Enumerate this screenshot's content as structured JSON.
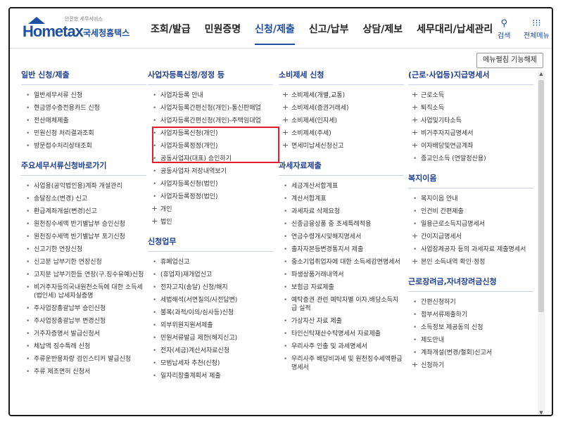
{
  "header": {
    "logo_tag": "안전한 세무서비스",
    "logo_brand": "Hometax",
    "logo_korean": "국세청홈택스",
    "nav": [
      "조회/발급",
      "민원증명",
      "신청/제출",
      "신고/납부",
      "상담/제보",
      "세무대리/납세관리"
    ],
    "active_nav": "신청/제출",
    "search_label": "검색",
    "allmenu_label": "전체메뉴"
  },
  "toolbar": {
    "menu_expand_label": "메뉴펼침 기능해제"
  },
  "columns": [
    {
      "sections": [
        {
          "title": "일반 신청/제출",
          "items": [
            {
              "label": "일반세무서류 신청"
            },
            {
              "label": "현금영수증전용카드 신청"
            },
            {
              "label": "전산매체제출"
            },
            {
              "label": "민원신청 처리결과조회"
            },
            {
              "label": "방문접수처리상태조회"
            }
          ]
        },
        {
          "title": "주요세무서류신청바로가기",
          "items": [
            {
              "label": "사업용(공익법인용)계좌 개설관리"
            },
            {
              "label": "송달장소(변경) 신고"
            },
            {
              "label": "환급계좌개설(변경)신고"
            },
            {
              "label": "원천징수세액 반기별납부 승인신청"
            },
            {
              "label": "원천징수세액 반기별납부 포기신청"
            },
            {
              "label": "신고기한 연장신청"
            },
            {
              "label": "신고분 납부기한 연장신청"
            },
            {
              "label": "고지분 납부기한등 연장(구.징수유예)신청"
            },
            {
              "label": "비거주자등의국내원천소득에 대한 소득세(법인세) 납세자실증명"
            },
            {
              "label": "주사업장총괄납부 승인신청"
            },
            {
              "label": "주사업장총괄납부 변경신청"
            },
            {
              "label": "거주자증명서 발급신청서"
            },
            {
              "label": "체납액 징수특례 신청"
            },
            {
              "label": "주류운반용차량 검인스티커 발급신청"
            },
            {
              "label": "주류 제조면허 신청서"
            }
          ]
        }
      ]
    },
    {
      "sections": [
        {
          "title": "사업자등록신청/정정 등",
          "items": [
            {
              "label": "사업자등록 안내"
            },
            {
              "label": "사업자등록간편신청(개인)-통신판매업"
            },
            {
              "label": "사업자등록간편신청(개인)-주택임대업"
            },
            {
              "label": "사업자등록신청(개인)"
            },
            {
              "label": "사업자등록정정(개인)"
            },
            {
              "label": "공동사업자(대표) 승인하기"
            },
            {
              "label": "공동사업자 저장내역보기"
            },
            {
              "label": "사업자등록신청(법인)"
            },
            {
              "label": "사업자등록정정(법인)"
            },
            {
              "label": "개인",
              "plus": true
            },
            {
              "label": "법인",
              "plus": true
            }
          ]
        },
        {
          "title": "신청업무",
          "items": [
            {
              "label": "휴폐업신고"
            },
            {
              "label": "(휴업자)재개업신고"
            },
            {
              "label": "전자고지(송달) 신청/해지"
            },
            {
              "label": "세법해석(서면질의/사전답변)"
            },
            {
              "label": "불복(과적/이의/심사등)신청"
            },
            {
              "label": "외부위원지원서제출"
            },
            {
              "label": "민원서류발급 제한(해지신고)"
            },
            {
              "label": "전자(세금)계산서자료신청"
            },
            {
              "label": "모범납세자 추천(신청)"
            },
            {
              "label": "일자리창출계획서 제출"
            }
          ]
        }
      ]
    },
    {
      "sections": [
        {
          "title": "소비제세 신청",
          "items": [
            {
              "label": "소비제세(개별,교통)",
              "plus": true
            },
            {
              "label": "소비제세(증권거래세)",
              "plus": true
            },
            {
              "label": "소비제세(인지세)",
              "plus": true
            },
            {
              "label": "소비제세(주세)",
              "plus": true
            },
            {
              "label": "면세미납세신청신고",
              "plus": true
            }
          ]
        },
        {
          "title": "과세자료제출",
          "items": [
            {
              "label": "세금계산서합계표"
            },
            {
              "label": "계산서합계표"
            },
            {
              "label": "과세자료 삭제요청"
            },
            {
              "label": "신종금융상품 중 조세특례적용"
            },
            {
              "label": "연금수령개시및해지명세서"
            },
            {
              "label": "출자자본등변경통지서 제출"
            },
            {
              "label": "중소기업취업자에 대한 소득세감면명세서"
            },
            {
              "label": "파생상품거래내역서"
            },
            {
              "label": "보험금 자료제출"
            },
            {
              "label": "예탁증권 관련 예탁자별 이자.배당소득지급 실적"
            },
            {
              "label": "가상자산 자료 제출"
            },
            {
              "label": "타인신탁재산수탁명세서 자료제출"
            },
            {
              "label": "우리사주 인출 및 과세명세서"
            },
            {
              "label": "우리사주 배당비과세 및 원천징수세액환급명세서"
            }
          ]
        }
      ]
    },
    {
      "sections": [
        {
          "title": "(근로·사업등)지급명세서",
          "items": [
            {
              "label": "근로소득",
              "plus": true
            },
            {
              "label": "퇴직소득",
              "plus": true
            },
            {
              "label": "사업및기타소득",
              "plus": true
            },
            {
              "label": "비거주자지급명세서",
              "plus": true
            },
            {
              "label": "이자배당및연금계좌",
              "plus": true
            },
            {
              "label": "종교인소득 (연말정산용)"
            }
          ]
        },
        {
          "title": "복지이음",
          "items": [
            {
              "label": "복지이음 안내"
            },
            {
              "label": "인건비 간편제출"
            },
            {
              "label": "일용근로소득지급명세서"
            },
            {
              "label": "간이지급명세서",
              "plus": true
            },
            {
              "label": "사업장제공자 등의 과세자료 제출명세서"
            },
            {
              "label": "본인 소득내역 확인·정정",
              "plus": true
            }
          ]
        },
        {
          "title": "근로장려금,자녀장려금신청",
          "items": [
            {
              "label": "간편신청하기"
            },
            {
              "label": "첨부서류제출하기"
            },
            {
              "label": "소득정보 제공동의 신청"
            },
            {
              "label": "제도안내"
            },
            {
              "label": "계좌개설(변경/철회)신고서"
            },
            {
              "label": "신청하기",
              "plus": true
            }
          ]
        }
      ]
    }
  ],
  "colors": {
    "brand": "#1f4fa3",
    "highlight": "#e21e2a",
    "section_title": "#1f3f8f"
  }
}
